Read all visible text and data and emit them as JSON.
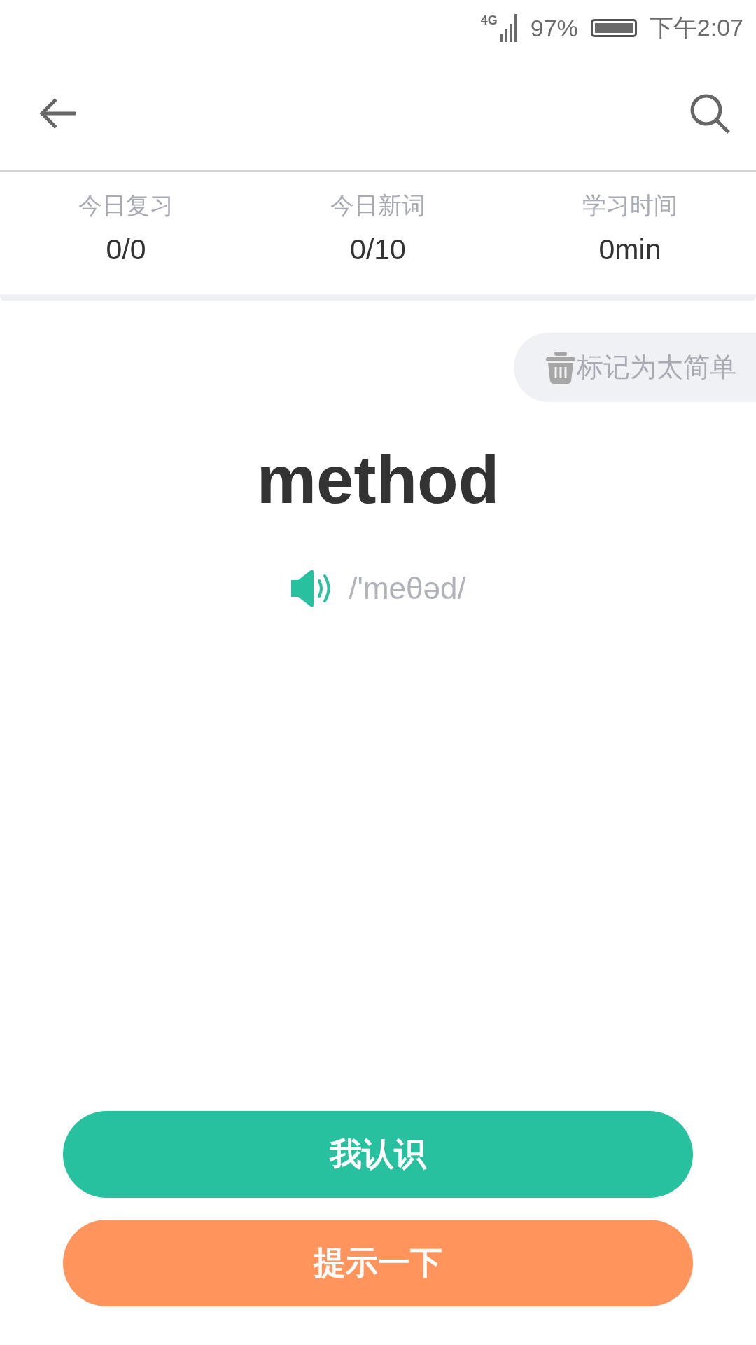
{
  "status_bar": {
    "network": "4G",
    "battery": "97%",
    "time": "下午2:07"
  },
  "stats": [
    {
      "label": "今日复习",
      "value": "0/0"
    },
    {
      "label": "今日新词",
      "value": "0/10"
    },
    {
      "label": "学习时间",
      "value": "0min"
    }
  ],
  "mark_button": {
    "label": "标记为太简单"
  },
  "word": "method",
  "phonetic": "/'meθəd/",
  "buttons": [
    {
      "label": "我认识",
      "color": "#27c19f"
    },
    {
      "label": "提示一下",
      "color": "#ff945d"
    }
  ]
}
